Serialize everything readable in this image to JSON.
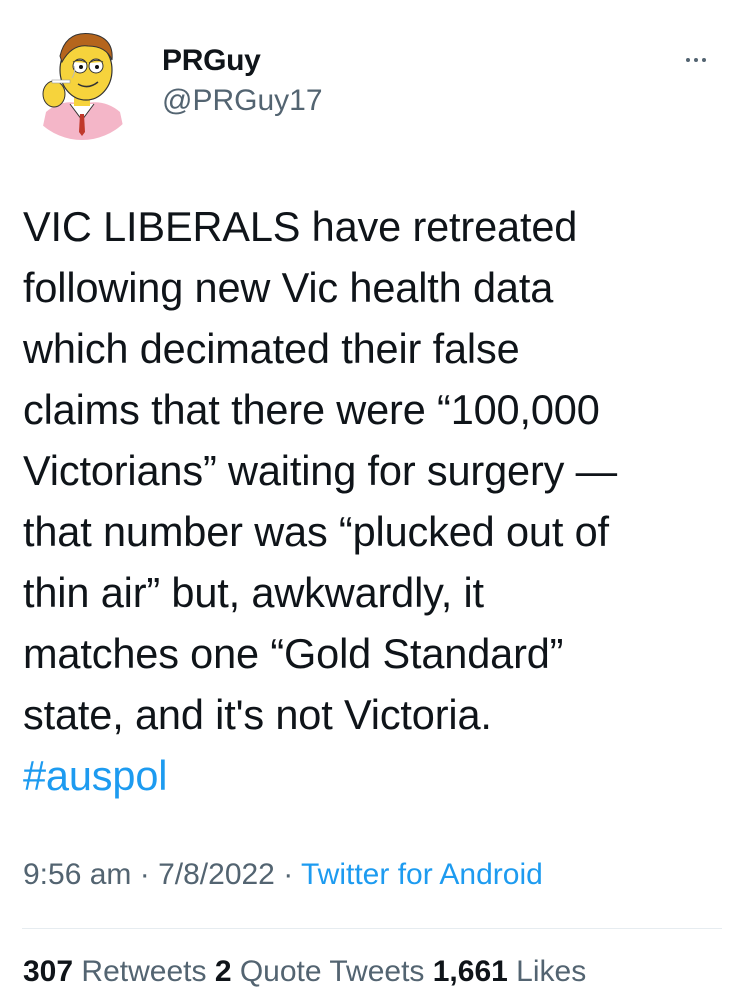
{
  "tweet": {
    "author": {
      "display_name": "PRGuy",
      "handle": "@PRGuy17",
      "avatar_icon": "cartoon-man-avatar"
    },
    "more_icon": "ellipsis-icon",
    "text_main": "VIC LIBERALS have retreated\nfollowing new Vic health data\nwhich decimated their false\nclaims that there were “100,000\nVictorians” waiting for surgery —\nthat number was “plucked out of\nthin air” but, awkwardly, it\nmatches one “Gold Standard”\nstate, and it's not Victoria.\n",
    "hashtag": "#auspol",
    "time": "9:56 am",
    "separator": "·",
    "date": "7/8/2022",
    "source": "Twitter for Android"
  },
  "stats": {
    "retweets_count": "307",
    "retweets_label": "Retweets",
    "quotes_count": "2",
    "quotes_label": "Quote Tweets",
    "likes_count": "1,661",
    "likes_label": "Likes"
  },
  "colors": {
    "text": "#0f1419",
    "secondary": "#536471",
    "link": "#1d9bf0",
    "divider": "#e6ecf0"
  }
}
